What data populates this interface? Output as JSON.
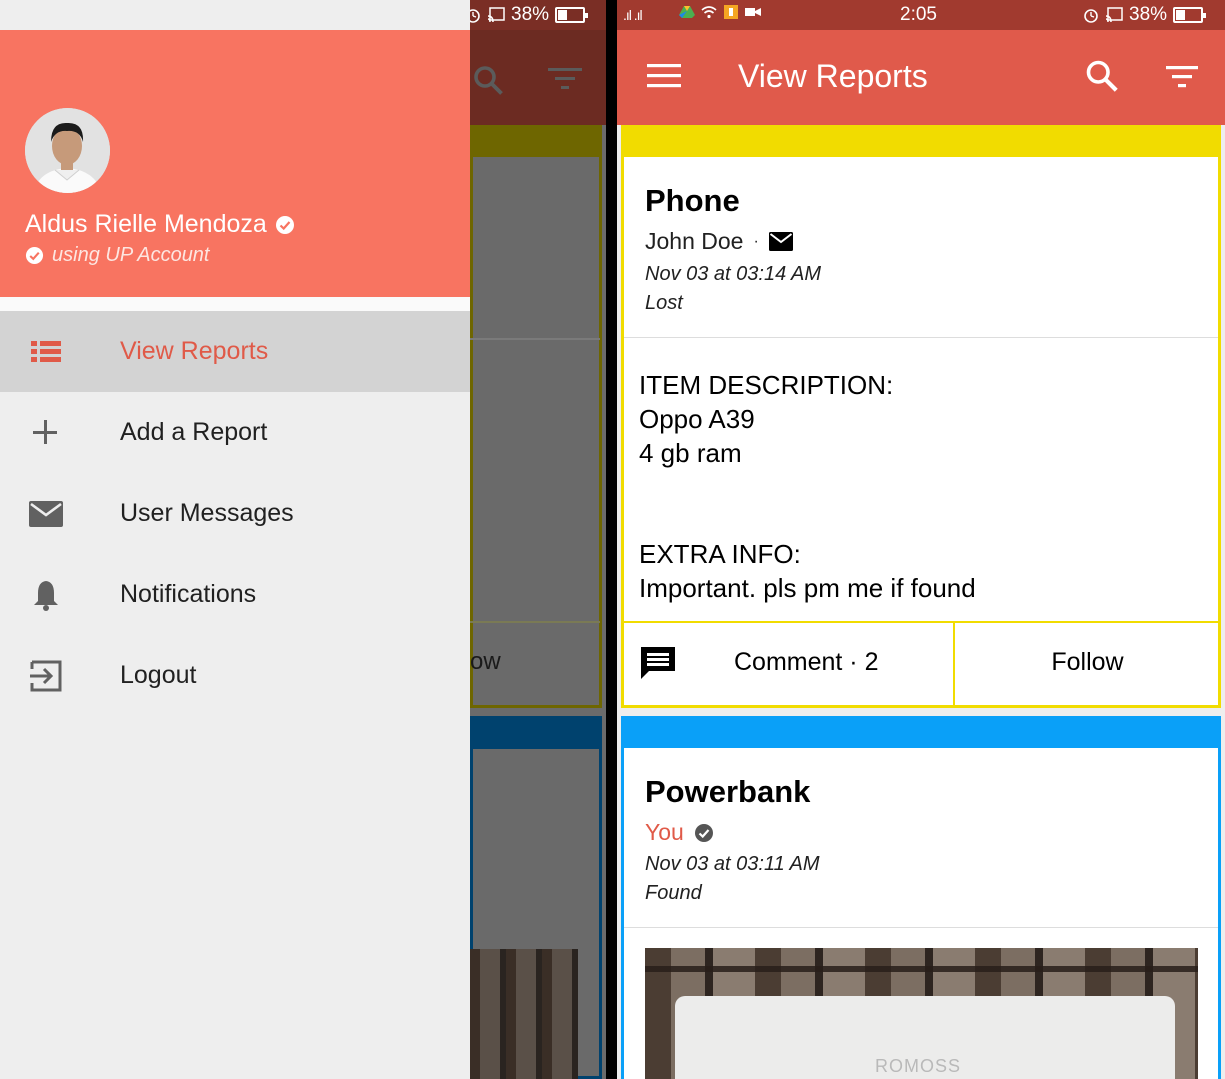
{
  "status_bar": {
    "time": "2:05",
    "battery": "38%",
    "signal": ".ıl .ıl"
  },
  "drawer": {
    "user": {
      "name": "Aldus Rielle Mendoza",
      "account_note": "using UP Account"
    },
    "menu": [
      {
        "label": "View Reports",
        "icon": "list-icon",
        "active": true
      },
      {
        "label": "Add a Report",
        "icon": "plus-icon",
        "active": false
      },
      {
        "label": "User Messages",
        "icon": "mail-icon",
        "active": false
      },
      {
        "label": "Notifications",
        "icon": "bell-icon",
        "active": false
      },
      {
        "label": "Logout",
        "icon": "logout-icon",
        "active": false
      }
    ]
  },
  "background_app": {
    "follow_fragment": "ow"
  },
  "app": {
    "title": "View Reports",
    "reports": [
      {
        "title": "Phone",
        "user": "John Doe",
        "separator": "·",
        "date": "Nov 03 at 03:14 AM",
        "status": "Lost",
        "stripe_color": "#f1dc00",
        "item_description_label": "ITEM DESCRIPTION:",
        "item_description_lines": [
          "Oppo A39",
          "4 gb ram"
        ],
        "extra_info_label": "EXTRA INFO:",
        "extra_info": "Important. pls pm me if found",
        "comment_label": "Comment · 2",
        "follow_label": "Follow"
      },
      {
        "title": "Powerbank",
        "user": "You",
        "date": "Nov 03 at 03:11 AM",
        "status": "Found",
        "stripe_color": "#0aa0f8",
        "photo_brand": "ROMOSS"
      }
    ]
  },
  "colors": {
    "accent": "#e05a4b",
    "drawer_header": "#f87461",
    "active_menu_text": "#e05a48"
  }
}
